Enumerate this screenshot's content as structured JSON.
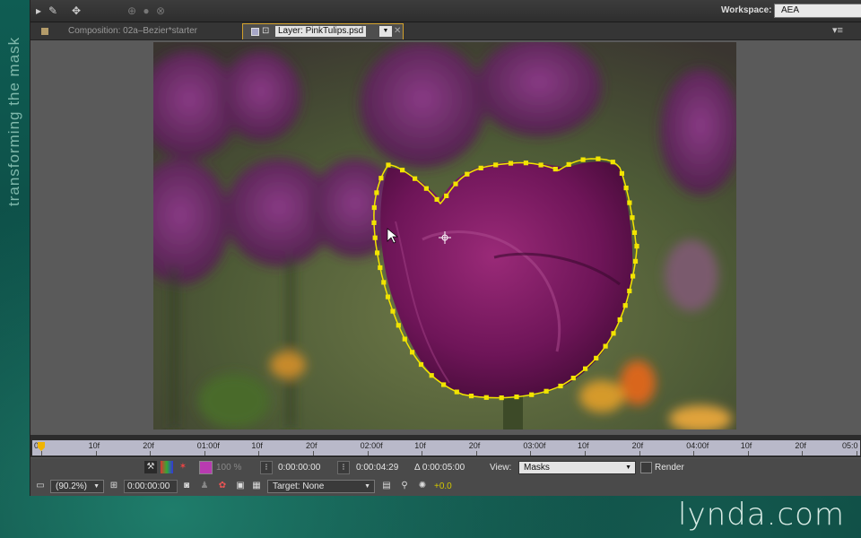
{
  "caption": {
    "vertical_title": "transforming the mask",
    "watermark": "lynda.com"
  },
  "toolbar": {
    "workspace_label": "Workspace:",
    "workspace_value": "AEA"
  },
  "tabs": {
    "composition": "Composition: 02a–Bezier*starter",
    "layer": "Layer: PinkTulips.psd"
  },
  "timeline": {
    "ruler_labels": [
      "0f",
      "10f",
      "20f",
      "01:00f",
      "10f",
      "20f",
      "02:00f",
      "10f",
      "20f",
      "03:00f",
      "10f",
      "20f",
      "04:00f",
      "10f",
      "20f",
      "05:0"
    ]
  },
  "controls": {
    "opacity": "100 %",
    "in_time": "0:00:00:00",
    "out_time": "0:00:04:29",
    "duration": "Δ 0:00:05:00",
    "view_label": "View:",
    "view_value": "Masks",
    "render_label": "Render",
    "zoom_value": "(90.2%)",
    "current_time": "0:00:00:00",
    "target": "Target: None",
    "offset": "+0.0"
  },
  "colors": {
    "mask_path": "#f2e400",
    "accent": "#d3a12b"
  },
  "icons": [
    "selection-tool-icon",
    "pen-tool-icon",
    "puppet-tool-icon",
    "lock-icon",
    "panel-menu-icon",
    "camera-icon",
    "color-channels-icon",
    "toggle-transparency-grid-icon",
    "region-of-interest-icon",
    "snapshot-icon",
    "show-snapshot-icon"
  ]
}
